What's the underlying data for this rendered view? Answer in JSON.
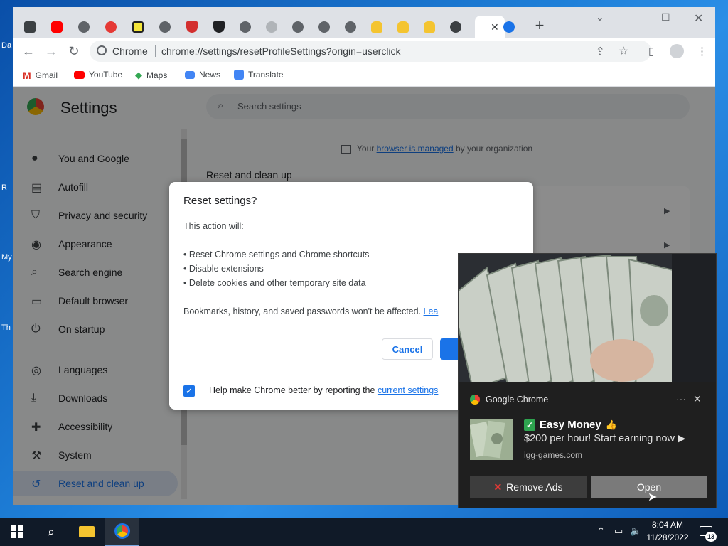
{
  "desktop": {
    "labels": [
      "Da",
      "R",
      "My",
      "Th"
    ]
  },
  "browser": {
    "omnibox": {
      "site_label": "Chrome",
      "url": "chrome://settings/resetProfileSettings?origin=userclick"
    },
    "bookmarks": [
      {
        "label": "Gmail",
        "icon": "gmail-icon",
        "color": "#d93025"
      },
      {
        "label": "YouTube",
        "icon": "youtube-icon",
        "color": "#ff0000"
      },
      {
        "label": "Maps",
        "icon": "maps-icon",
        "color": "#34a853"
      },
      {
        "label": "News",
        "icon": "news-icon",
        "color": "#4285f4"
      },
      {
        "label": "Translate",
        "icon": "translate-icon",
        "color": "#4285f4"
      }
    ]
  },
  "settings": {
    "title": "Settings",
    "search_placeholder": "Search settings",
    "managed_prefix": "Your",
    "managed_link": "browser is managed",
    "managed_suffix": "by your organization",
    "section_title": "Reset and clean up",
    "nav": [
      {
        "label": "You and Google",
        "icon": "person-icon"
      },
      {
        "label": "Autofill",
        "icon": "clipboard-icon"
      },
      {
        "label": "Privacy and security",
        "icon": "shield-icon"
      },
      {
        "label": "Appearance",
        "icon": "palette-icon"
      },
      {
        "label": "Search engine",
        "icon": "search-icon"
      },
      {
        "label": "Default browser",
        "icon": "browser-icon"
      },
      {
        "label": "On startup",
        "icon": "power-icon"
      },
      {
        "label": "Languages",
        "icon": "globe-icon"
      },
      {
        "label": "Downloads",
        "icon": "download-icon"
      },
      {
        "label": "Accessibility",
        "icon": "accessibility-icon"
      },
      {
        "label": "System",
        "icon": "wrench-icon"
      },
      {
        "label": "Reset and clean up",
        "icon": "history-icon"
      }
    ]
  },
  "dialog": {
    "title": "Reset settings?",
    "intro": "This action will:",
    "bullets": [
      "• Reset Chrome settings and Chrome shortcuts",
      "• Disable extensions",
      "• Delete cookies and other temporary site data"
    ],
    "note": "Bookmarks, history, and saved passwords won't be affected.",
    "note_link": "Lea",
    "cancel_label": "Cancel",
    "checkbox_label": "Help make Chrome better by reporting the",
    "checkbox_link": "current settings",
    "checkbox_checked": true
  },
  "notification": {
    "app_name": "Google Chrome",
    "title": "Easy Money",
    "body": "$200 per hour! Start earning now ▶",
    "source": "igg-games.com",
    "remove_label": "Remove Ads",
    "open_label": "Open"
  },
  "taskbar": {
    "time": "8:04 AM",
    "date": "11/28/2022",
    "notification_count": "13"
  }
}
